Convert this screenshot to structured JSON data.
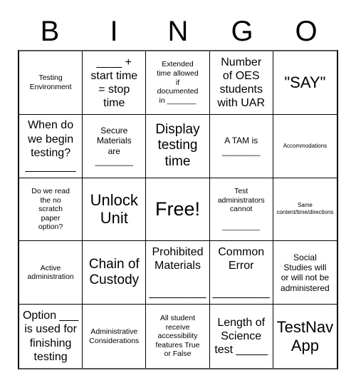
{
  "card": {
    "title": "BINGO",
    "header_letters": [
      "B",
      "I",
      "N",
      "G",
      "O"
    ],
    "columns": 5,
    "rows": 5,
    "free_space_index": 12,
    "colors": {
      "background": "#ffffff",
      "text": "#000000",
      "grid_line": "#000000",
      "outer_border": "#555555"
    }
  },
  "cells": [
    {
      "text": "Testing\nEnvironment",
      "size": "sm"
    },
    {
      "text": "____ +\nstart time\n= stop\ntime",
      "size": "lg"
    },
    {
      "text": "Extended\ntime allowed\nif\ndocumented\nin _______",
      "size": "sm"
    },
    {
      "text": "Number\nof OES\nstudents\nwith UAR",
      "size": "lg"
    },
    {
      "text": "\"SAY\"",
      "size": "xxl"
    },
    {
      "text": "When do\nwe begin\ntesting?\n________",
      "size": "lg"
    },
    {
      "text": "Secure\nMaterials\nare\n________",
      "size": "md"
    },
    {
      "text": "Display\ntesting\ntime",
      "size": "xl"
    },
    {
      "text": "A TAM is\n________",
      "size": "md"
    },
    {
      "text": "Accommodations",
      "size": "xs"
    },
    {
      "text": "Do we read\nthe no\nscratch\npaper\noption?",
      "size": "sm"
    },
    {
      "text": "Unlock\nUnit",
      "size": "xxl"
    },
    {
      "text": "Free!",
      "size": "free"
    },
    {
      "text": "Test\nadministrators\ncannot\n\n_________",
      "size": "sm"
    },
    {
      "text": "Same\ncontent/time/directions",
      "size": "xs"
    },
    {
      "text": "Active\nadministration",
      "size": "sm"
    },
    {
      "text": "Chain of\nCustody",
      "size": "xl"
    },
    {
      "text": "Prohibited\nMaterials\n\n_________",
      "size": "lg"
    },
    {
      "text": "Common\nError\n\n_________",
      "size": "lg"
    },
    {
      "text": "Social\nStudies will\nor will not be\nadministered",
      "size": "md"
    },
    {
      "text": "Option ___\nis used for\nfinishing\ntesting",
      "size": "lg"
    },
    {
      "text": "Administrative\nConsiderations",
      "size": "sm"
    },
    {
      "text": "All student\nreceive\naccessibility\nfeatures True\nor False",
      "size": "sm"
    },
    {
      "text": "Length of\nScience\ntest _____",
      "size": "lg"
    },
    {
      "text": "TestNav\nApp",
      "size": "xxl"
    }
  ]
}
